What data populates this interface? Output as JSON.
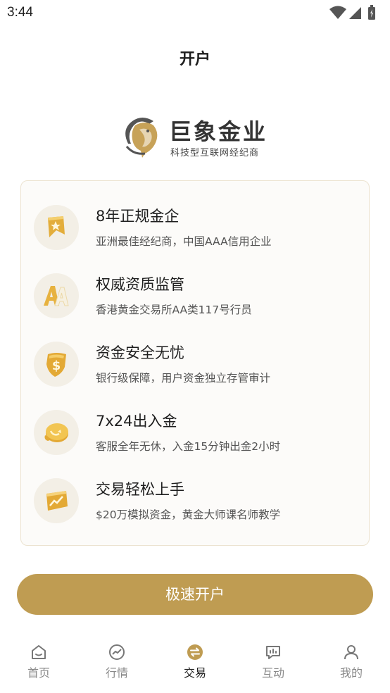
{
  "status_bar": {
    "time": "3:44"
  },
  "header": {
    "title": "开户"
  },
  "brand": {
    "name": "巨象金业",
    "slogan": "科技型互联网经纪商"
  },
  "features": [
    {
      "title": "8年正规金企",
      "desc": "亚洲最佳经纪商，中国AAA信用企业",
      "icon": "star-ribbon-icon"
    },
    {
      "title": "权威资质监管",
      "desc": "香港黄金交易所AA类117号行员",
      "icon": "aa-badge-icon"
    },
    {
      "title": "资金安全无忧",
      "desc": "银行级保障，用户资金独立存管审计",
      "icon": "dollar-shield-icon"
    },
    {
      "title": "7x24出入金",
      "desc": "客服全年无休，入金15分钟出金2小时",
      "icon": "coin-swap-icon"
    },
    {
      "title": "交易轻松上手",
      "desc": "$20万模拟资金，黄金大师课名师教学",
      "icon": "trend-card-icon"
    }
  ],
  "cta": {
    "label": "极速开户"
  },
  "tabs": [
    {
      "label": "首页",
      "icon": "home-icon",
      "active": false
    },
    {
      "label": "行情",
      "icon": "chart-icon",
      "active": false
    },
    {
      "label": "交易",
      "icon": "swap-icon",
      "active": true
    },
    {
      "label": "互动",
      "icon": "chat-icon",
      "active": false
    },
    {
      "label": "我的",
      "icon": "user-icon",
      "active": false
    }
  ],
  "colors": {
    "accent": "#bf9c52",
    "icon_bg": "#f3efe6",
    "card_border": "#ece3d0"
  }
}
